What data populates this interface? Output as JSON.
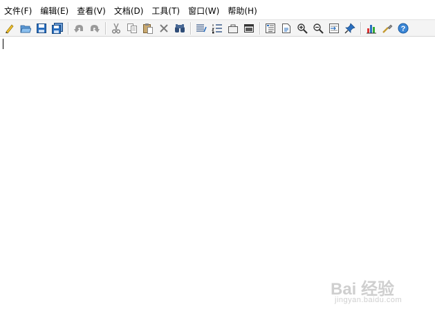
{
  "menubar": {
    "items": [
      {
        "label": "文件(F)"
      },
      {
        "label": "编辑(E)"
      },
      {
        "label": "查看(V)"
      },
      {
        "label": "文档(D)"
      },
      {
        "label": "工具(T)"
      },
      {
        "label": "窗口(W)"
      },
      {
        "label": "帮助(H)"
      }
    ]
  },
  "toolbar": {
    "groups": [
      [
        "new-icon",
        "open-icon",
        "save-icon",
        "save-all-icon"
      ],
      [
        "undo-icon",
        "redo-icon"
      ],
      [
        "cut-icon",
        "copy-icon",
        "paste-icon",
        "delete-icon",
        "find-icon"
      ],
      [
        "list-icon",
        "numbered-list-icon",
        "toolbox-icon",
        "console-icon"
      ],
      [
        "outline-icon",
        "document-icon",
        "zoom-in-icon",
        "zoom-out-icon",
        "goto-icon",
        "pin-icon"
      ],
      [
        "chart-icon",
        "tools-icon",
        "help-icon"
      ]
    ]
  },
  "watermark": {
    "main": "Bai 经验",
    "sub": "jingyan.baidu.com"
  },
  "colors": {
    "toolbar_bg": "#f4f4f4",
    "icon_blue": "#2a6fbf",
    "icon_gray": "#8a8a8a"
  }
}
